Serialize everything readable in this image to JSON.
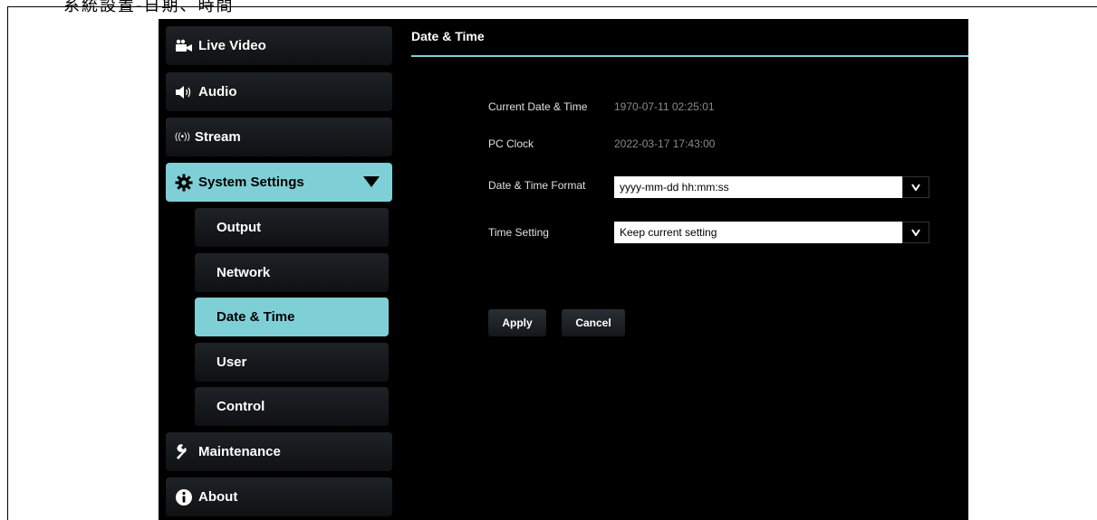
{
  "doc_heading": "系統設置-日期、時間",
  "sidebar": {
    "live_video": "Live Video",
    "audio": "Audio",
    "stream": "Stream",
    "stream_icon": "((•))",
    "system_settings": "System Settings",
    "output": "Output",
    "network": "Network",
    "date_time": "Date & Time",
    "user": "User",
    "control": "Control",
    "maintenance": "Maintenance",
    "about": "About"
  },
  "content": {
    "title": "Date & Time",
    "current_label": "Current Date & Time",
    "current_value": "1970-07-11 02:25:01",
    "pc_clock_label": "PC Clock",
    "pc_clock_value": "2022-03-17 17:43:00",
    "format_label": "Date & Time Format",
    "format_value": "yyyy-mm-dd hh:mm:ss",
    "time_setting_label": "Time Setting",
    "time_setting_value": "Keep current setting",
    "apply": "Apply",
    "cancel": "Cancel"
  },
  "colors": {
    "accent": "#7fcfd6",
    "panel_bg": "#000000",
    "nav_bg": "#1a1d20"
  }
}
